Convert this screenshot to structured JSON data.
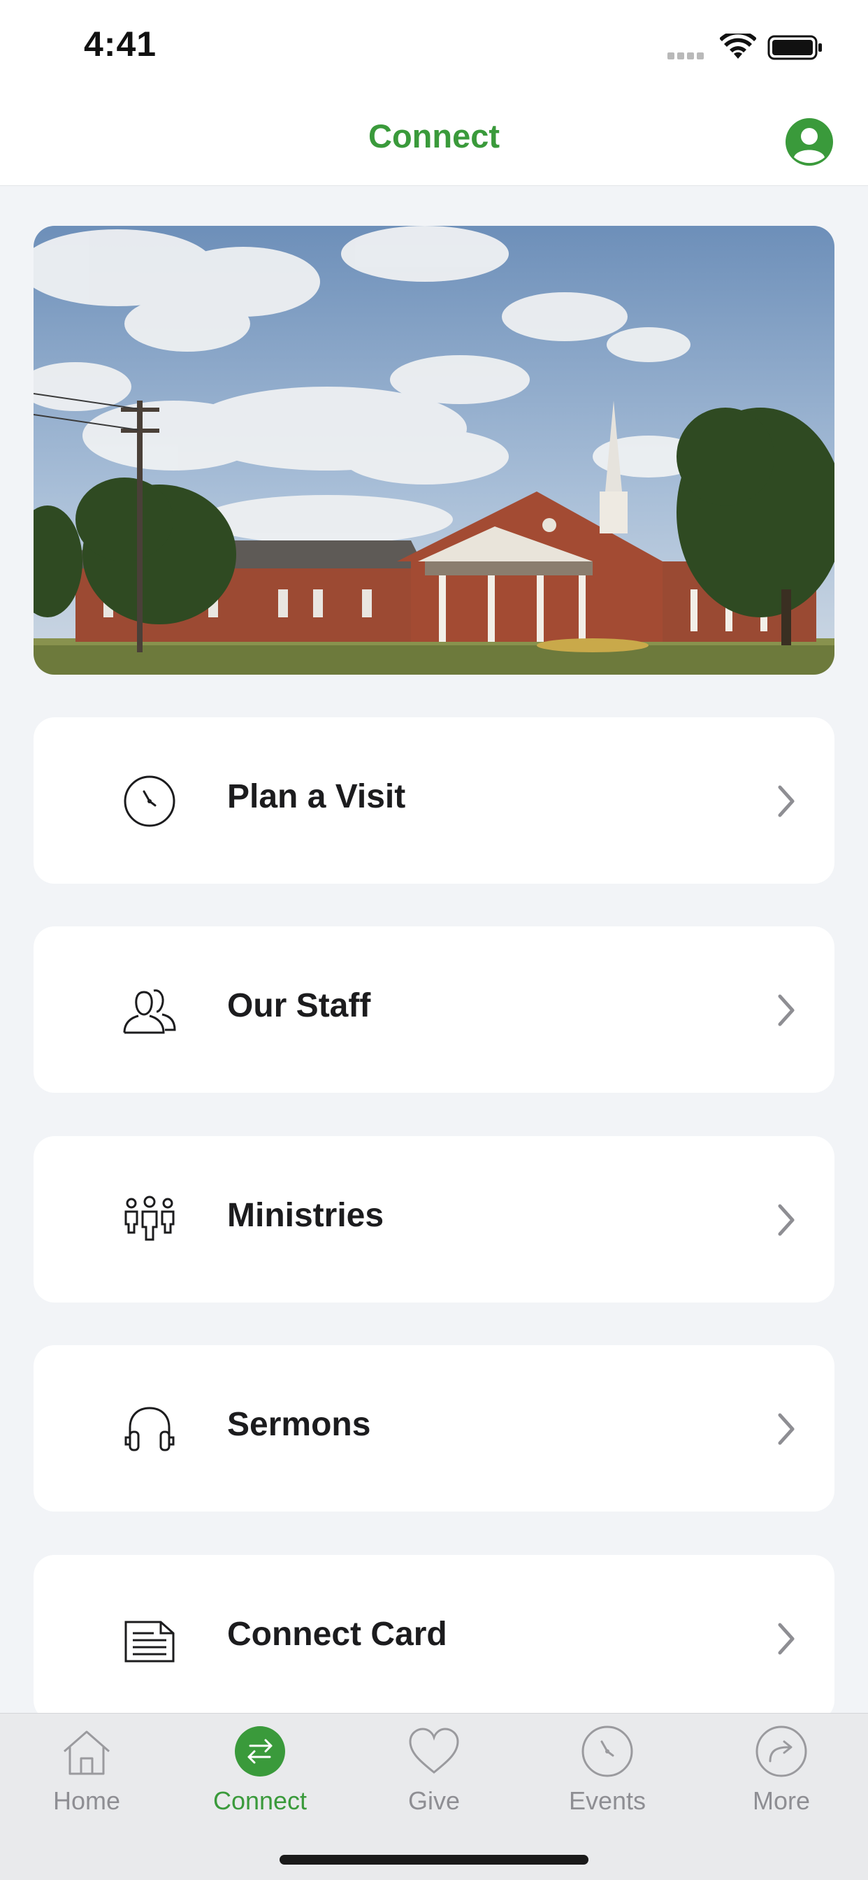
{
  "status_bar": {
    "time": "4:41"
  },
  "header": {
    "title": "Connect"
  },
  "menu": [
    {
      "label": "Plan a Visit",
      "icon": "clock-icon"
    },
    {
      "label": "Our Staff",
      "icon": "people-icon"
    },
    {
      "label": "Ministries",
      "icon": "group-icon"
    },
    {
      "label": "Sermons",
      "icon": "headphones-icon"
    },
    {
      "label": "Connect Card",
      "icon": "document-icon"
    }
  ],
  "tab_bar": {
    "items": [
      {
        "label": "Home",
        "icon": "home-icon"
      },
      {
        "label": "Connect",
        "icon": "connect-icon",
        "active": true
      },
      {
        "label": "Give",
        "icon": "heart-icon"
      },
      {
        "label": "Events",
        "icon": "clock-icon"
      },
      {
        "label": "More",
        "icon": "share-arrow-icon"
      }
    ]
  },
  "colors": {
    "accent": "#3a9a3b",
    "background": "#f2f4f7",
    "card": "#ffffff",
    "tab_inactive": "#8e8e93"
  }
}
